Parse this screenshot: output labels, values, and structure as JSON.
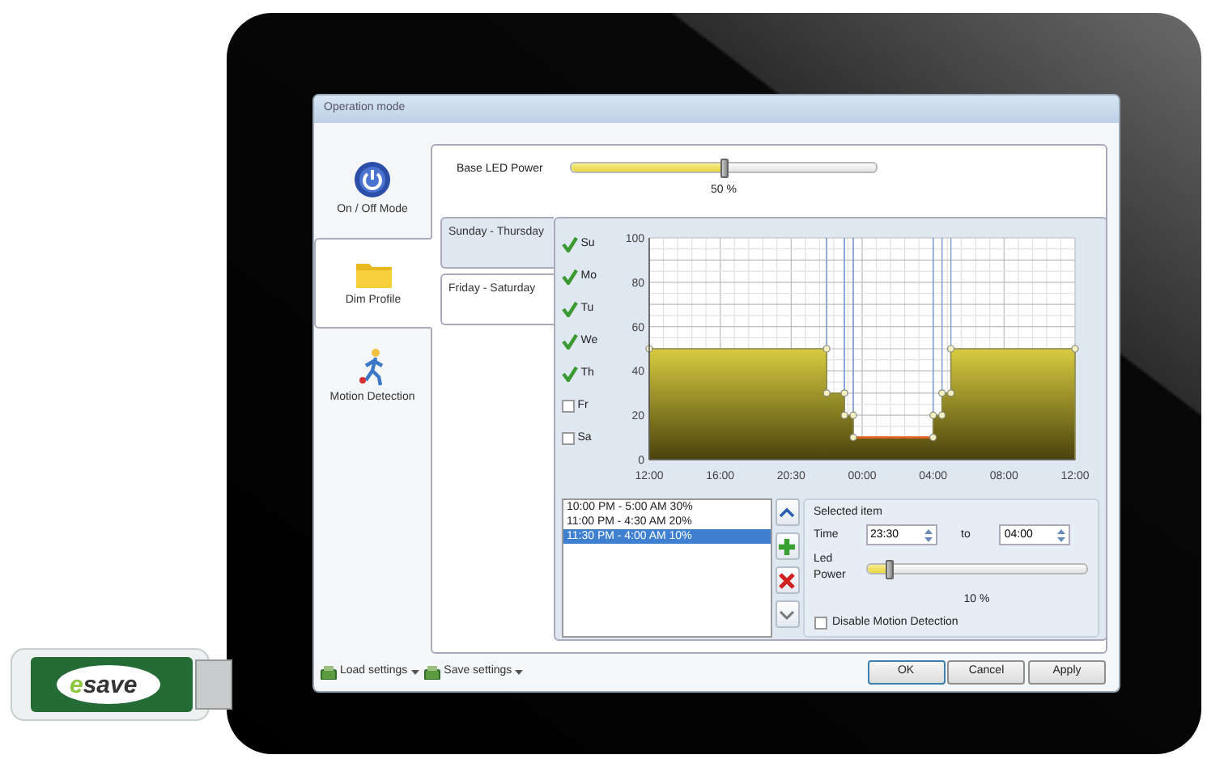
{
  "window": {
    "title": "Operation mode"
  },
  "side_tabs": [
    {
      "label": "On / Off Mode",
      "kind": "power",
      "selected": false
    },
    {
      "label": "Dim Profile",
      "kind": "folder",
      "selected": true
    },
    {
      "label": "Motion Detection",
      "kind": "walker",
      "selected": false
    }
  ],
  "base_power": {
    "label": "Base LED Power",
    "level": 0.5,
    "reading": "50 %"
  },
  "day_tabs": [
    {
      "label": "Sunday - Thursday",
      "selected": true
    },
    {
      "label": "Friday - Saturday",
      "selected": false
    }
  ],
  "days": [
    {
      "label": "Su",
      "checked": true
    },
    {
      "label": "Mo",
      "checked": true
    },
    {
      "label": "Tu",
      "checked": true
    },
    {
      "label": "We",
      "checked": true
    },
    {
      "label": "Th",
      "checked": true
    },
    {
      "label": "Fr",
      "checked": false
    },
    {
      "label": "Sa",
      "checked": false
    }
  ],
  "profile": {
    "y_labels": [
      "100",
      "80",
      "60",
      "40",
      "20",
      "0"
    ],
    "x_labels": [
      "12:00",
      "16:00",
      "20:30",
      "00:00",
      "04:00",
      "08:00",
      "12:00"
    ]
  },
  "periods": [
    {
      "text": "10:00 PM - 5:00 AM  30%",
      "selected": false
    },
    {
      "text": "11:00 PM - 4:30 AM  20%",
      "selected": false
    },
    {
      "text": "11:30 PM - 4:00 AM  10%",
      "selected": true
    }
  ],
  "selected_item": {
    "title": "Selected item",
    "time_label": "Time",
    "from": "23:30",
    "to_label": "to",
    "to": "04:00",
    "power_label": "Led Power",
    "level": 0.1,
    "reading": "10 %",
    "disable_motion": {
      "label": "Disable Motion Detection",
      "checked": false
    }
  },
  "footer": {
    "load": "Load settings",
    "save": "Save settings",
    "buttons": [
      "OK",
      "Cancel",
      "Apply"
    ]
  },
  "usb_stick": {
    "logo_head": "e",
    "logo_tail": "save"
  }
}
